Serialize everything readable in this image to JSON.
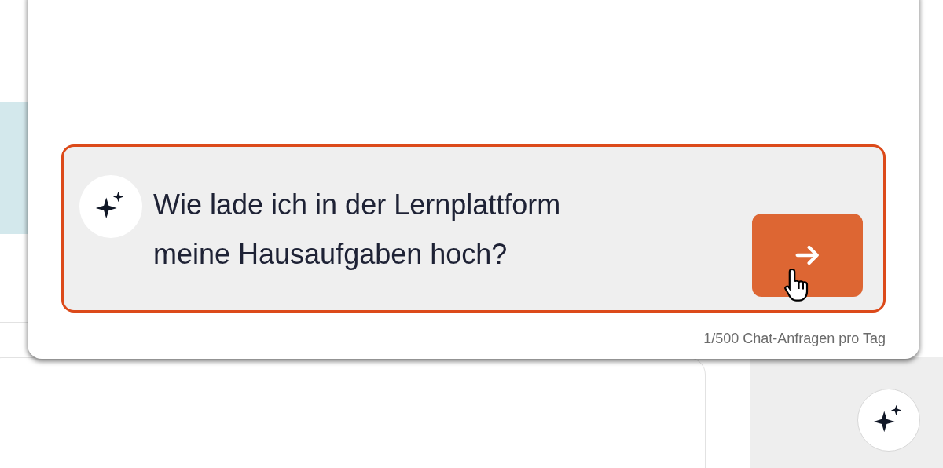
{
  "chat_panel": {
    "message_field": {
      "value": "Wie lade ich in der Lernplattform meine Hausaufgaben hoch?"
    },
    "usage_counter": "1/500 Chat-Anfragen pro Tag"
  }
}
